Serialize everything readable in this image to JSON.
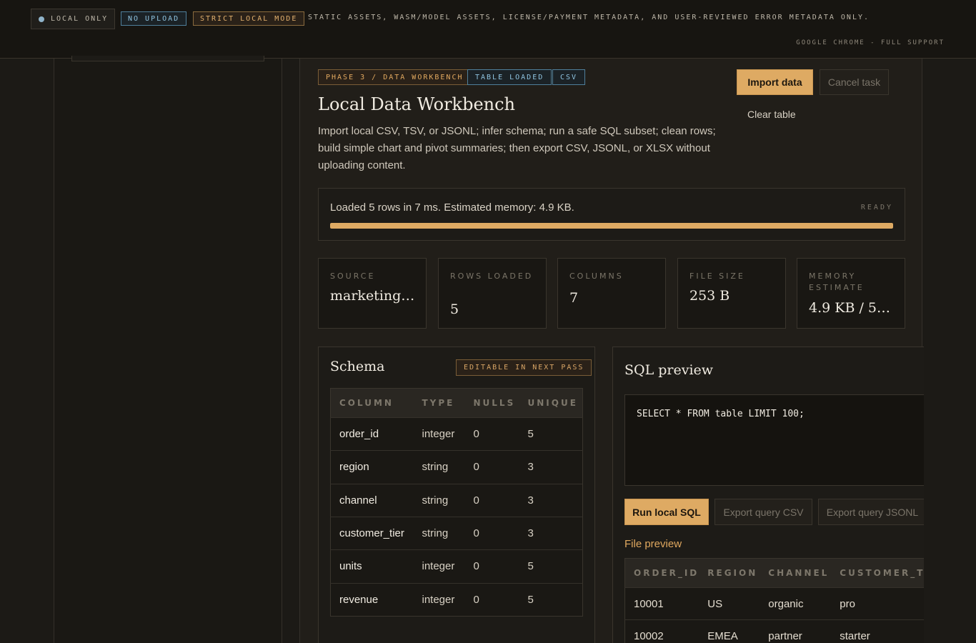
{
  "banner": {
    "local_only": "LOCAL ONLY",
    "no_upload": "NO UPLOAD",
    "strict_mode": "STRICT LOCAL MODE",
    "policy_text": "STATIC ASSETS, WASM/MODEL ASSETS, LICENSE/PAYMENT METADATA, AND USER-REVIEWED ERROR METADATA ONLY.",
    "browser_support": "GOOGLE CHROME - FULL SUPPORT"
  },
  "header": {
    "tags": [
      "PHASE 3 / DATA WORKBENCH",
      "TABLE LOADED",
      "CSV"
    ],
    "title": "Local Data Workbench",
    "description": "Import local CSV, TSV, or JSONL; infer schema; run a safe SQL subset; clean rows; build simple chart and pivot summaries; then export CSV, JSONL, or XLSX without uploading content.",
    "import_label": "Import data",
    "cancel_label": "Cancel task",
    "clear_label": "Clear table"
  },
  "status": {
    "message": "Loaded 5 rows in 7 ms. Estimated memory: 4.9 KB.",
    "state": "READY",
    "progress_percent": 100
  },
  "stats": [
    {
      "label": "SOURCE",
      "value": "marketing-..."
    },
    {
      "label": "ROWS LOADED",
      "value": "5"
    },
    {
      "label": "COLUMNS",
      "value": "7"
    },
    {
      "label": "FILE SIZE",
      "value": "253 B"
    },
    {
      "label": "MEMORY ESTIMATE",
      "value": "4.9 KB / 51..."
    }
  ],
  "schema": {
    "title": "Schema",
    "badge": "EDITABLE IN NEXT PASS",
    "headers": [
      "COLUMN",
      "TYPE",
      "NULLS",
      "UNIQUE"
    ],
    "rows": [
      [
        "order_id",
        "integer",
        "0",
        "5"
      ],
      [
        "region",
        "string",
        "0",
        "3"
      ],
      [
        "channel",
        "string",
        "0",
        "3"
      ],
      [
        "customer_tier",
        "string",
        "0",
        "3"
      ],
      [
        "units",
        "integer",
        "0",
        "5"
      ],
      [
        "revenue",
        "integer",
        "0",
        "5"
      ]
    ]
  },
  "sql": {
    "title": "SQL preview",
    "query": "SELECT * FROM table LIMIT 100;",
    "run_label": "Run local SQL",
    "export_csv_label": "Export query CSV",
    "export_jsonl_label": "Export query JSONL",
    "preview_label": "File preview",
    "preview_headers": [
      "ORDER_ID",
      "REGION",
      "CHANNEL",
      "CUSTOMER_TIER"
    ],
    "preview_rows": [
      [
        "10001",
        "US",
        "organic",
        "pro"
      ],
      [
        "10002",
        "EMEA",
        "partner",
        "starter"
      ]
    ]
  }
}
